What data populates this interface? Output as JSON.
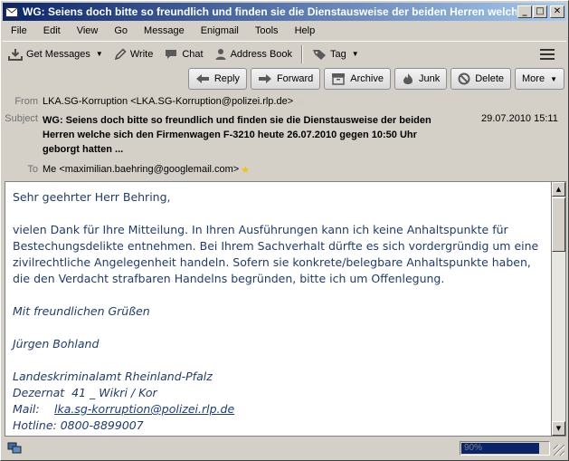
{
  "window": {
    "title": "WG: Seiens doch bitte so freundlich und finden sie die Dienstausweise der beiden Herren welche...",
    "minimize": "_",
    "maximize": "□",
    "close": "✕"
  },
  "menu": [
    "File",
    "Edit",
    "View",
    "Go",
    "Message",
    "Enigmail",
    "Tools",
    "Help"
  ],
  "toolbar": {
    "get_messages": "Get Messages",
    "write": "Write",
    "chat": "Chat",
    "address_book": "Address Book",
    "tag": "Tag",
    "menu_icon": "hamburger-menu-icon"
  },
  "header_buttons": {
    "reply": "Reply",
    "forward": "Forward",
    "archive": "Archive",
    "junk": "Junk",
    "delete": "Delete",
    "more": "More"
  },
  "message": {
    "from_label": "From",
    "from_value": "LKA.SG-Korruption <LKA.SG-Korruption@polizei.rlp.de>",
    "subject_label": "Subject",
    "subject_value": "WG: Seiens doch bitte so freundlich und finden sie die Dienstausweise der beiden Herren welche sich den Firmenwagen F-3210 heute 26.07.2010 gegen 10:50 Uhr geborgt hatten ...",
    "date": "29.07.2010 15:11",
    "to_label": "To",
    "to_value": "Me <maximilian.baehring@googlemail.com>"
  },
  "body": {
    "greeting": "Sehr geehrter Herr Behring,",
    "paragraph": "vielen Dank für Ihre Mitteilung. In Ihren Ausführungen kann ich keine Anhaltspunkte für Bestechungsdelikte entnehmen. Bei Ihrem Sachverhalt dürfte es sich vordergründig um eine zivilrechtliche Angelegenheit handeln. Sofern sie konkrete/belegbare Anhaltspunkte haben, die den Verdacht strafbaren Handelns begründen, bitte ich um Offenlegung.",
    "closing": "Mit freundlichen Grüßen",
    "signature_name": "Jürgen Bohland",
    "org": "Landeskriminalamt Rheinland-Pfalz",
    "dept": "Dezernat  41 _ Wikri / Kor",
    "mail_label": "Mail:",
    "mail_link": "lka.sg-korruption@polizei.rlp.de",
    "hotline": "Hotline: 0800-8899007"
  },
  "status": {
    "progress_percent": 90,
    "progress_text": "90%"
  },
  "colors": {
    "title_bar_start": "#0a246a",
    "title_bar_end": "#a6caf0",
    "body_text": "#1f3c6e",
    "star_filled": "#f2c300"
  }
}
